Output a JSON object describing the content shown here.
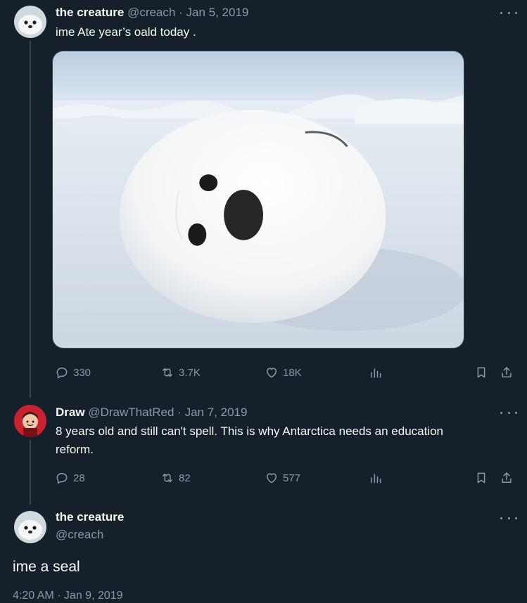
{
  "tweets": [
    {
      "name": "the creature",
      "handle": "@creach",
      "separator": "·",
      "date": "Jan 5, 2019",
      "text": "ime Ate year’s oald today .",
      "media": "photo-seal-pup",
      "actions": {
        "reply": "330",
        "retweet": "3.7K",
        "like": "18K"
      }
    },
    {
      "name": "Draw",
      "handle": "@DrawThatRed",
      "separator": "·",
      "date": "Jan 7, 2019",
      "text_line1": "8 years old and still can't spell. This is why Antarctica needs an education",
      "text_line2": "reform.",
      "actions": {
        "reply": "28",
        "retweet": "82",
        "like": "577"
      }
    }
  ],
  "main_tweet": {
    "name": "the creature",
    "handle": "@creach",
    "text": "ime a seal",
    "partial_meta": "4:20 AM · Jan 9, 2019"
  },
  "icons": {
    "reply": "reply-icon",
    "retweet": "retweet-icon",
    "like": "heart-icon",
    "views": "views-icon",
    "bookmark": "bookmark-icon",
    "share": "share-icon",
    "more": "more-icon"
  },
  "colors": {
    "background": "#15202b",
    "text_primary": "#f7f9f9",
    "text_secondary": "#8b98a5",
    "divider": "#38444d"
  }
}
